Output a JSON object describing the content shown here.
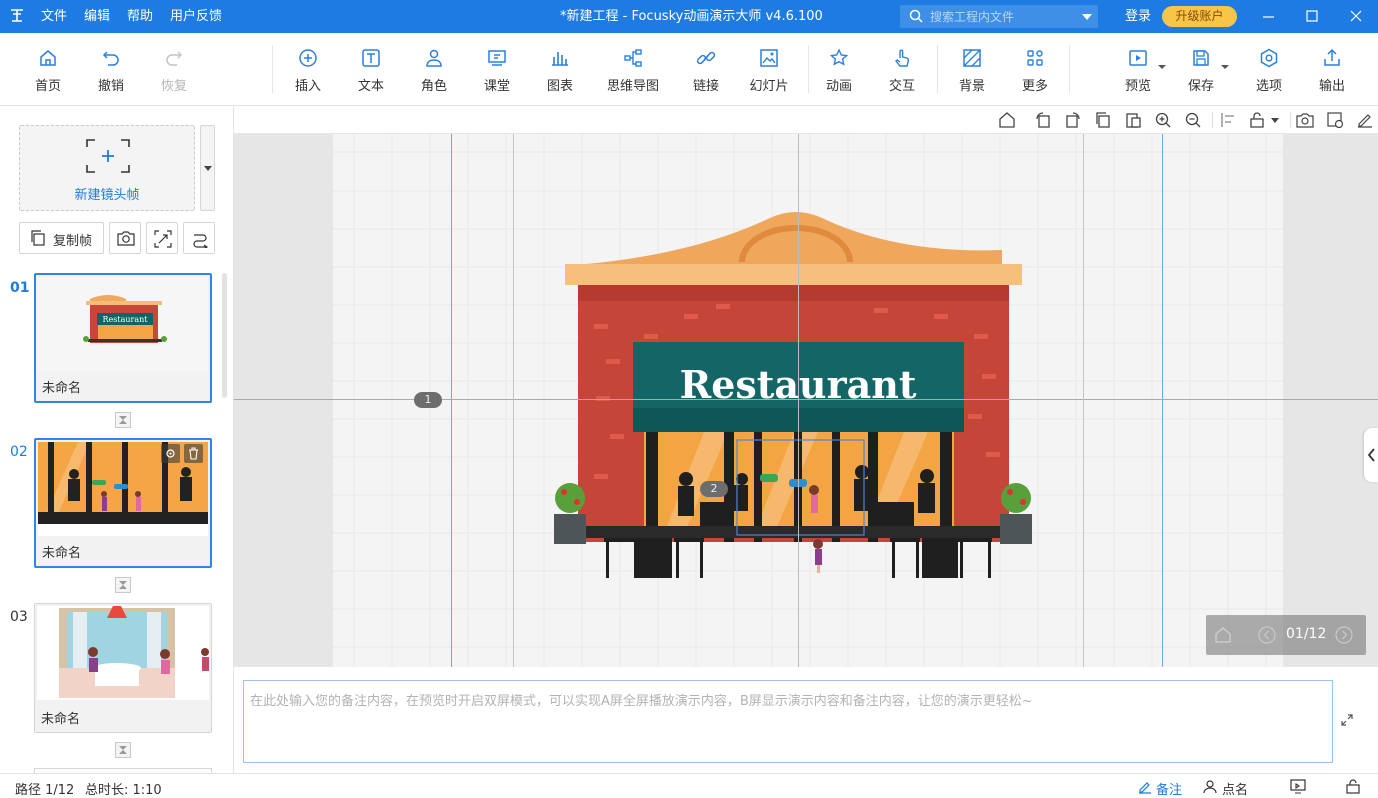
{
  "app": {
    "title": "*新建工程 - Focusky动画演示大师  v4.6.100",
    "menu": [
      "文件",
      "编辑",
      "帮助",
      "用户反馈"
    ],
    "search_placeholder": "搜索工程内文件",
    "login": "登录",
    "upgrade": "升级账户",
    "accent": "#1e7be2"
  },
  "toolbar": {
    "home": "首页",
    "undo": "撤销",
    "redo": "恢复",
    "insert": "插入",
    "text": "文本",
    "role": "角色",
    "class": "课堂",
    "chart": "图表",
    "mindmap": "思维导图",
    "link": "链接",
    "slide": "幻灯片",
    "animation": "动画",
    "interaction": "交互",
    "background": "背景",
    "more": "更多",
    "preview": "预览",
    "save": "保存",
    "options": "选项",
    "export": "输出"
  },
  "sidebar": {
    "new_frame": "新建镜头帧",
    "copy_frame": "复制帧",
    "frames": [
      {
        "num": "01",
        "name": "未命名"
      },
      {
        "num": "02",
        "name": "未命名"
      },
      {
        "num": "03",
        "name": "未命名"
      }
    ]
  },
  "canvas": {
    "restaurant_sign": "Restaurant",
    "frame_markers": [
      "1",
      "2"
    ],
    "page_indicator": "01/12"
  },
  "notes": {
    "placeholder": "在此处输入您的备注内容，在预览时开启双屏模式，可以实现A屏全屏播放演示内容，B屏显示演示内容和备注内容，让您的演示更轻松~"
  },
  "status": {
    "path": "路径 1/12",
    "duration": "总时长: 1:10",
    "notes": "备注",
    "rollcall": "点名"
  }
}
